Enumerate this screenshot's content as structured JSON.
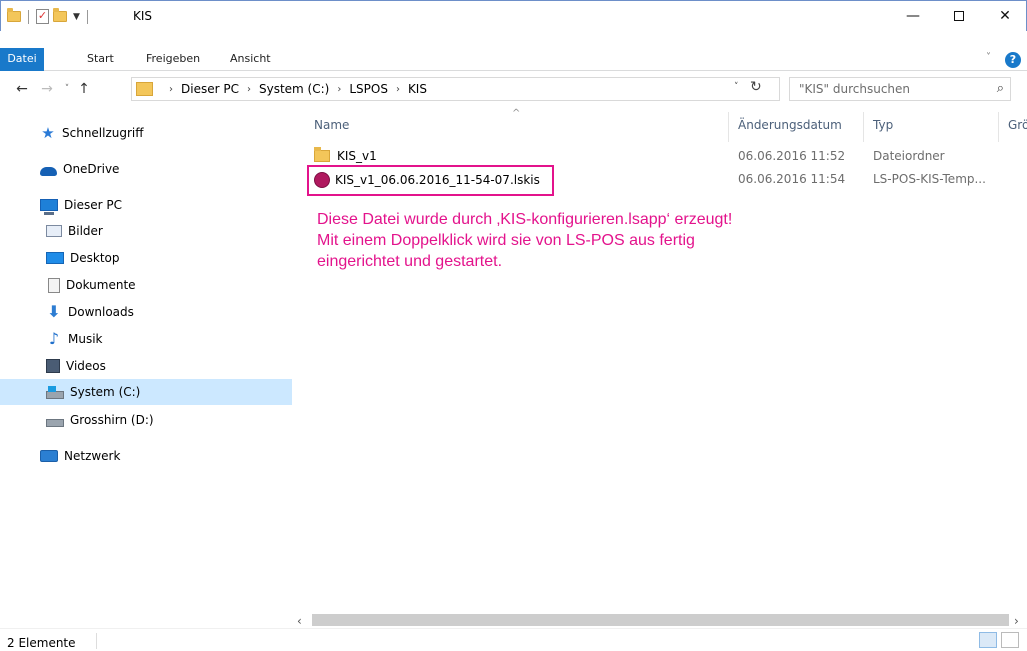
{
  "window": {
    "title": "KIS",
    "minimize": "—",
    "close": "✕"
  },
  "ribbon": {
    "tabs": [
      "Datei",
      "Start",
      "Freigeben",
      "Ansicht"
    ],
    "expand": "˅",
    "help": "?"
  },
  "address": {
    "back": "←",
    "forward": "→",
    "recent": "˅",
    "up": "↑",
    "breadcrumb": [
      "Dieser PC",
      "System (C:)",
      "LSPOS",
      "KIS"
    ],
    "separator": "›",
    "dropdown": "˅",
    "refresh": "↻"
  },
  "search": {
    "placeholder": "\"KIS\" durchsuchen",
    "icon": "⌕"
  },
  "navigation": {
    "items": [
      {
        "label": "Schnellzugriff",
        "icon": "star-icon"
      },
      {
        "label": "OneDrive",
        "icon": "cloud-icon"
      },
      {
        "label": "Dieser PC",
        "icon": "computer-icon"
      },
      {
        "label": "Bilder",
        "icon": "pictures-icon"
      },
      {
        "label": "Desktop",
        "icon": "desktop-icon"
      },
      {
        "label": "Dokumente",
        "icon": "documents-icon"
      },
      {
        "label": "Downloads",
        "icon": "download-icon"
      },
      {
        "label": "Musik",
        "icon": "music-icon"
      },
      {
        "label": "Videos",
        "icon": "videos-icon"
      },
      {
        "label": "System (C:)",
        "icon": "system-drive-icon",
        "selected": true
      },
      {
        "label": "Grosshirn (D:)",
        "icon": "drive-icon"
      },
      {
        "label": "Netzwerk",
        "icon": "network-icon"
      }
    ]
  },
  "columns": {
    "name": "Name",
    "date": "Änderungsdatum",
    "type": "Typ",
    "size": "Grö"
  },
  "files": [
    {
      "name": "KIS_v1",
      "date": "06.06.2016 11:52",
      "type": "Dateiordner",
      "icon": "folder-icon"
    },
    {
      "name": "KIS_v1_06.06.2016_11-54-07.lskis",
      "date": "06.06.2016 11:54",
      "type": "LS-POS-KIS-Temp...",
      "icon": "lskis-file-icon"
    }
  ],
  "annotation": {
    "lines": [
      "Diese Datei wurde durch ‚KIS-konfigurieren.lsapp‘ erzeugt!",
      "Mit einem Doppelklick wird sie von LS-POS aus fertig",
      "eingerichtet und gestartet."
    ],
    "color": "#e3138c"
  },
  "statusbar": {
    "count": "2 Elemente"
  },
  "colors": {
    "accent": "#1979ca",
    "selection": "#cce8ff"
  }
}
